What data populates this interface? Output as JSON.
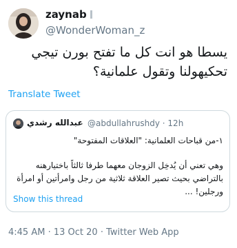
{
  "author": {
    "name": "zaynab",
    "handle": "@WonderWoman_z"
  },
  "tweet": {
    "text": "يسطا هو انت كل ما تفتح بورن تيجي تحكيهولنا وتقول علمانية؟",
    "translate_label": "Translate Tweet"
  },
  "quoted": {
    "name": "عبدالله رشدي",
    "handle": "@abdullahrushdy",
    "separator": "·",
    "time": "12h",
    "line1": "١-من قباحات العلمانية: \"العلاقات المفتوحة\"",
    "line2": "وهي تعني أن يُدخِل الزوجان معهما طرفا ثالثاً باختيارهنه بالتراضي بحيث تصير العلاقة ثلاثية من رجل وامرأتين أو امرأة ورجلين! ...",
    "show_thread": "Show this thread"
  },
  "footer": {
    "time": "4:45 AM",
    "separator": "·",
    "date": "13 Oct 20",
    "separator2": "·",
    "source": "Twitter Web App"
  },
  "colors": {
    "link": "#1da1f2",
    "secondary_text": "#657786",
    "border": "#cfd9de"
  },
  "icons": {
    "profile_badge": "flag-icon"
  }
}
